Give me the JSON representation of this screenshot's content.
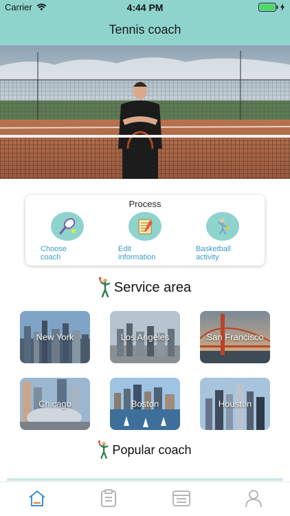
{
  "status": {
    "carrier": "Carrier",
    "time": "4:44 PM"
  },
  "nav": {
    "title": "Tennis coach"
  },
  "process": {
    "title": "Process",
    "steps": [
      {
        "label_line1": "Choose",
        "label_line2": "coach",
        "icon": "tennis-racket-icon"
      },
      {
        "label_line1": "Edit",
        "label_line2": "information",
        "icon": "notebook-icon"
      },
      {
        "label_line1": "Basketball",
        "label_line2": "activity",
        "icon": "activity-icon"
      }
    ]
  },
  "service_area": {
    "title": "Service area",
    "cities": [
      "New York",
      "Los Angeles",
      "San Francisco",
      "Chicago",
      "Boston",
      "Houston"
    ]
  },
  "popular": {
    "title": "Popular coach"
  },
  "tabs": [
    "home-tab-icon",
    "orders-tab-icon",
    "schedule-tab-icon",
    "profile-tab-icon"
  ],
  "colors": {
    "accent": "#8fd3cd",
    "tab_active": "#3a8fd6",
    "tab_inactive": "#b5b5b5"
  }
}
